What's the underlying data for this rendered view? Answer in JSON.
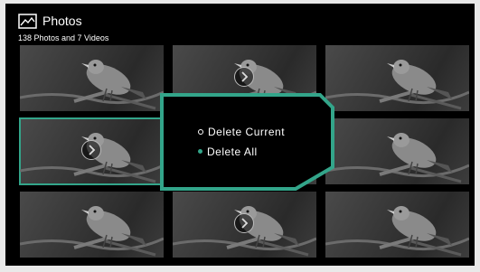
{
  "header": {
    "icon": "photo-gallery-icon",
    "title": "Photos",
    "subtitle": "138 Photos and 7 Videos"
  },
  "grid": {
    "rows": 3,
    "columns": 3,
    "tiles": [
      {
        "type": "photo",
        "selected": false
      },
      {
        "type": "video",
        "selected": false
      },
      {
        "type": "photo",
        "selected": false
      },
      {
        "type": "video",
        "selected": true
      },
      {
        "type": "photo",
        "selected": false
      },
      {
        "type": "photo",
        "selected": false
      },
      {
        "type": "photo",
        "selected": false
      },
      {
        "type": "video",
        "selected": false
      },
      {
        "type": "photo",
        "selected": false
      }
    ]
  },
  "dialog": {
    "options": [
      {
        "label": "Delete Current",
        "focused": false
      },
      {
        "label": "Delete All",
        "focused": true
      }
    ]
  },
  "colors": {
    "accent": "#33a58a",
    "background": "#000000",
    "text": "#ffffff"
  }
}
